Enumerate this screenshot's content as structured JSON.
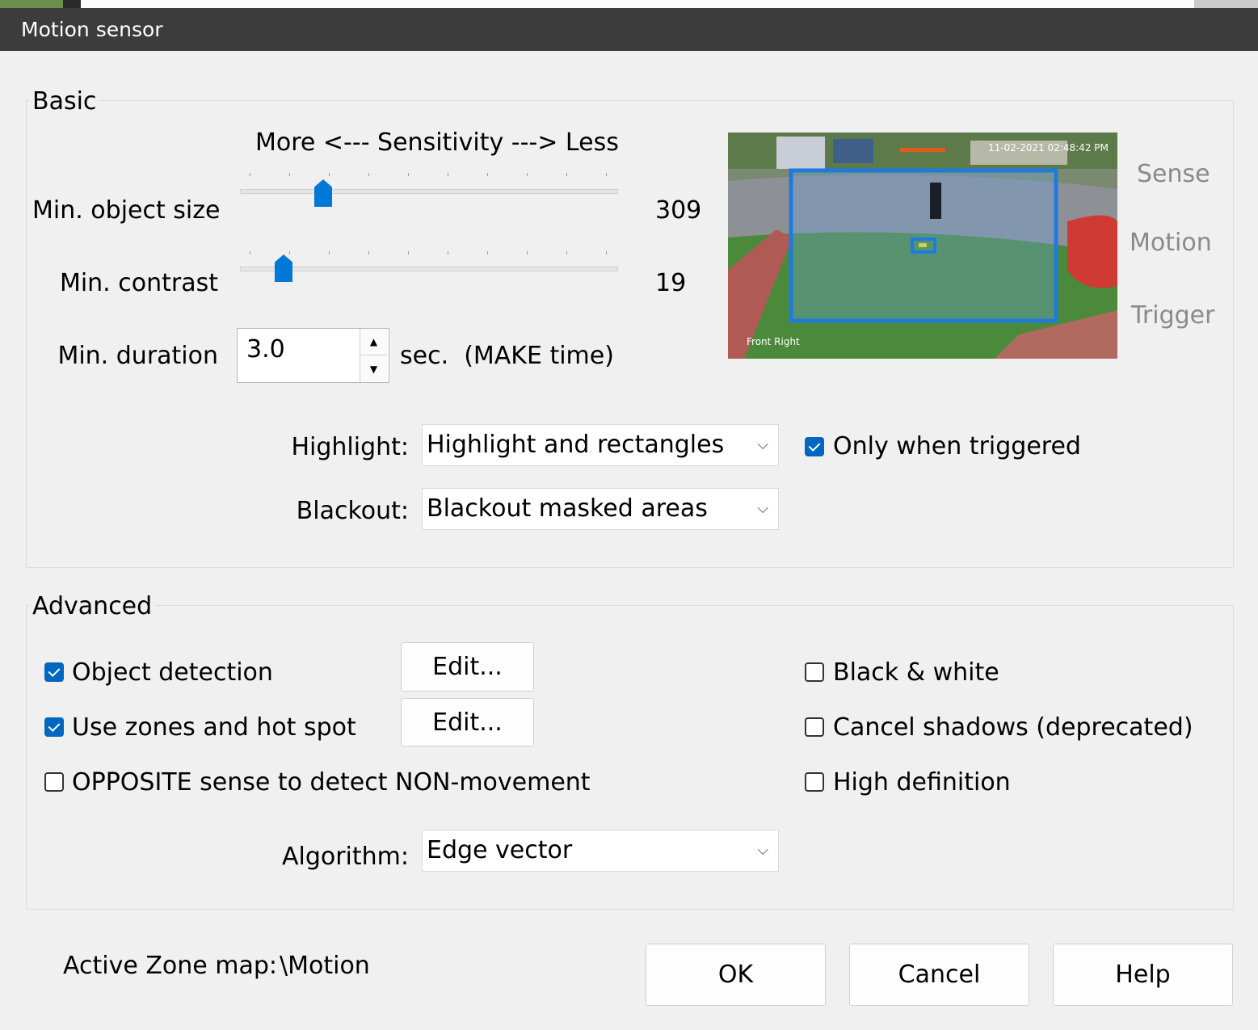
{
  "window": {
    "title": "Motion sensor"
  },
  "basic": {
    "legend": "Basic",
    "sensitivity_header": "More <--- Sensitivity ---> Less",
    "min_object_size": {
      "label": "Min. object size",
      "value": "309",
      "slider_fraction": 0.22
    },
    "min_contrast": {
      "label": "Min. contrast",
      "value": "19",
      "slider_fraction": 0.11
    },
    "min_duration": {
      "label": "Min. duration",
      "value": "3.0",
      "unit": "sec.  (MAKE time)"
    },
    "highlight": {
      "label": "Highlight:",
      "selected": "Highlight and rectangles"
    },
    "only_when_triggered": {
      "label": "Only when triggered",
      "checked": true
    },
    "blackout": {
      "label": "Blackout:",
      "selected": "Blackout masked areas"
    },
    "preview": {
      "timestamp": "11-02-2021 02:48:42 PM",
      "camera_name": "Front Right",
      "status": {
        "sense": "Sense",
        "motion": "Motion",
        "trigger": "Trigger"
      }
    }
  },
  "advanced": {
    "legend": "Advanced",
    "object_detection": {
      "label": "Object detection",
      "checked": true,
      "edit_label": "Edit..."
    },
    "use_zones": {
      "label": "Use zones and hot spot",
      "checked": true,
      "edit_label": "Edit..."
    },
    "opposite_sense": {
      "label": "OPPOSITE sense to detect NON-movement",
      "checked": false
    },
    "black_white": {
      "label": "Black & white",
      "checked": false
    },
    "cancel_shadows": {
      "label": "Cancel shadows (deprecated)",
      "checked": false
    },
    "high_definition": {
      "label": "High definition",
      "checked": false
    },
    "algorithm": {
      "label": "Algorithm:",
      "selected": "Edge vector"
    }
  },
  "footer": {
    "active_zone_label": "Active Zone map:",
    "active_zone_value": "\\Motion",
    "ok": "OK",
    "cancel": "Cancel",
    "help": "Help"
  },
  "colors": {
    "accent": "#0078d7",
    "titlebar": "#3c3c3c",
    "checkbox_on": "#0067c0"
  },
  "icons": {
    "spin_up": "▲",
    "spin_down": "▼",
    "dropdown": "⌵"
  }
}
